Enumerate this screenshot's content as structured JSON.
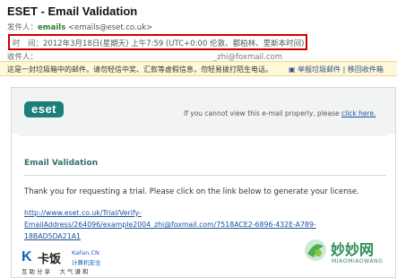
{
  "header": {
    "title": "ESET - Email Validation",
    "star_glyph": "☆",
    "sender_label": "发件人：",
    "sender_name": "emails",
    "sender_email": "<emails@eset.co.uk>",
    "time_label": "时　间：",
    "time_value": "2012年3月18日(星期天) 上午7:59 (UTC+0:00 伦敦、都柏林、里斯本时间)",
    "recipient_label": "收件人：",
    "recipient_value": "_zhi@foxmail.com"
  },
  "warning_bar": {
    "text": "这是一封垃圾箱中的邮件。请勿轻信中奖、汇款等虚假信息，勿轻易拨打陌生电话。",
    "link_not_spam": "举报垃圾邮件",
    "separator": "|",
    "link_move_inbox": "移回收件箱"
  },
  "email": {
    "logo_text": "eset",
    "cant_view_text": "If you cannot view this e-mail properly, please ",
    "click_here": "click here.",
    "section_title": "Email Validation",
    "body": "Thank you for requesting a trial. Please click on the link below to generate your license.",
    "url_line1": "http://www.eset.co.uk/Trial/Verify-",
    "url_line2": "EmailAddress/264096/example2004_zhi@foxmail.com/7518ACE2-6896-432E-A789-",
    "url_line3": "18BAD5DA21A1"
  },
  "footer": {
    "brand_k": "K",
    "brand_name": "卡饭",
    "brand_slogan": "互助分享　大气谦和",
    "brand_en": "KaFan.CN",
    "brand_cn": "计算机安全"
  },
  "watermark": {
    "name": "妙妙网",
    "sub": "MIAOMIAOWANG"
  },
  "colors": {
    "highlight_box": "#d10000",
    "eset_teal": "#1e7f7a",
    "link_blue": "#1a4f9c",
    "warning_bg": "#fff8d6"
  }
}
